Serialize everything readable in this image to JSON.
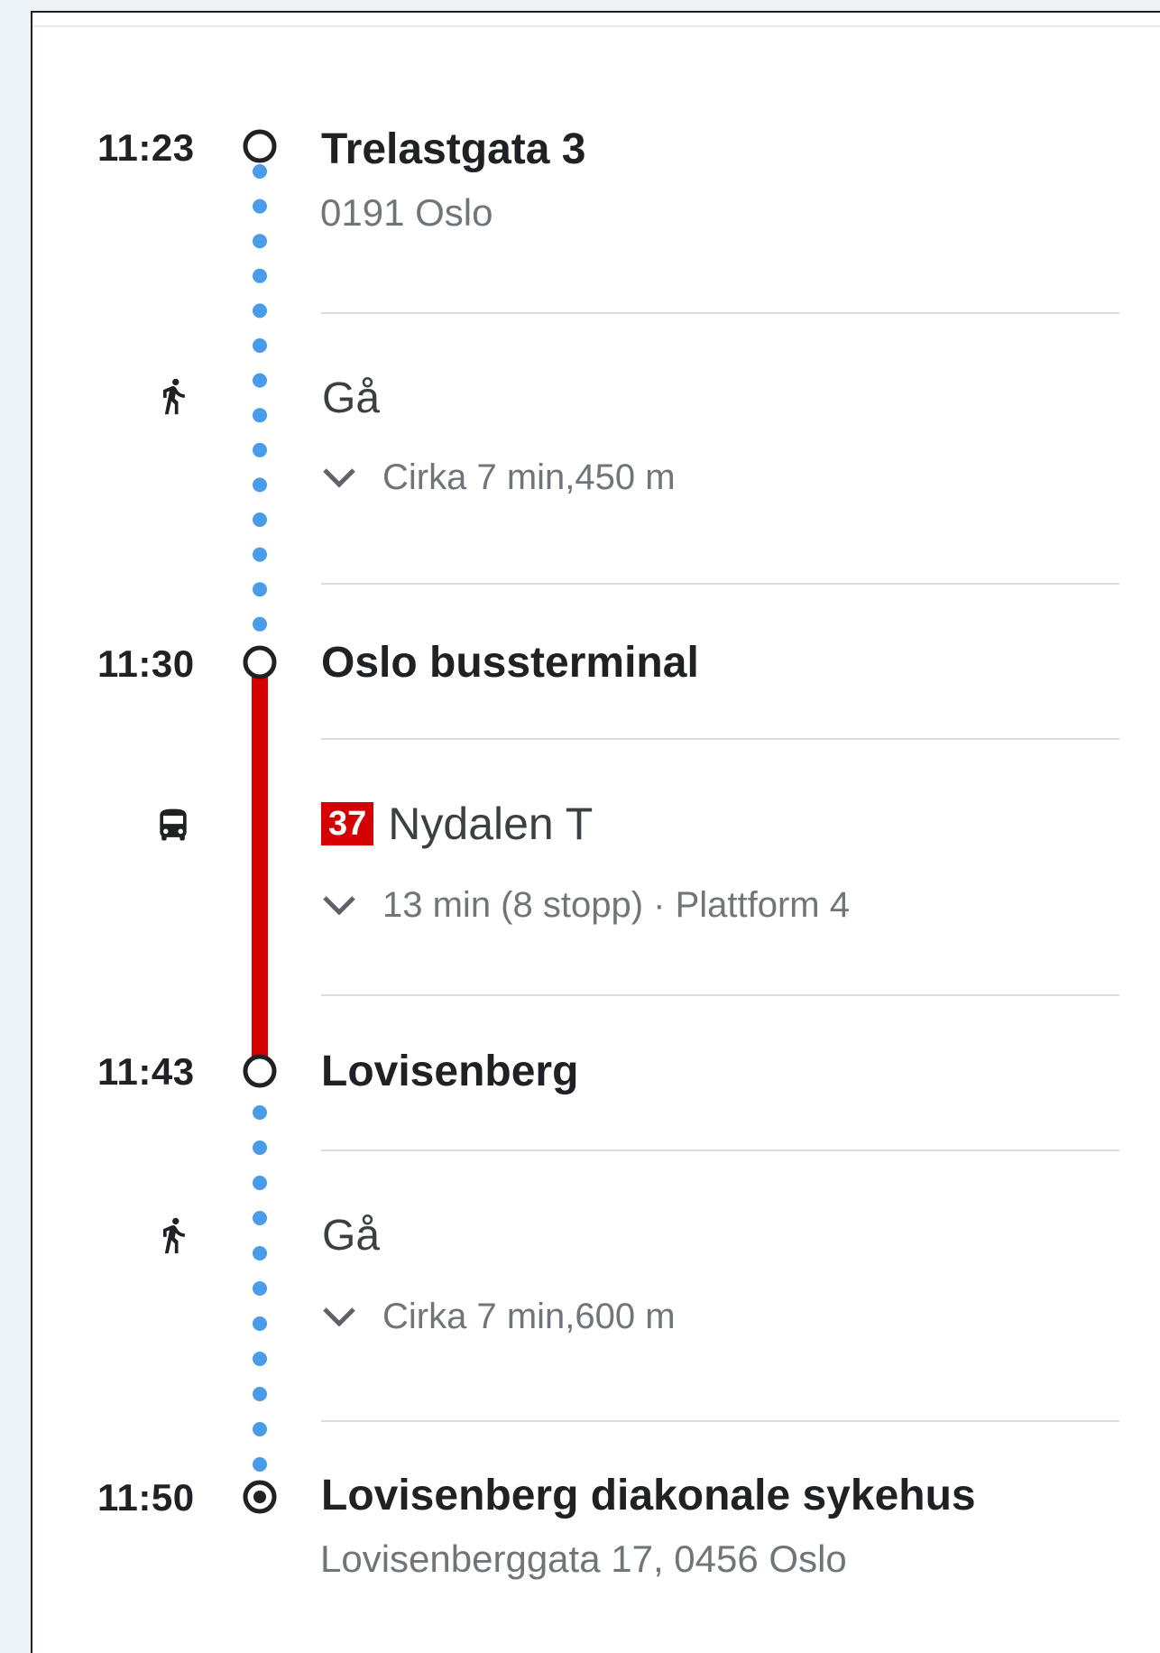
{
  "stops": [
    {
      "time": "11:23",
      "title": "Trelastgata 3",
      "subtitle": "0191 Oslo"
    },
    {
      "time": "11:30",
      "title": "Oslo bussterminal"
    },
    {
      "time": "11:43",
      "title": "Lovisenberg"
    },
    {
      "time": "11:50",
      "title": "Lovisenberg diakonale sykehus",
      "subtitle": "Lovisenberggata 17, 0456 Oslo"
    }
  ],
  "steps": [
    {
      "mode": "walk",
      "icon": "walk-icon",
      "label": "Gå",
      "detail": "Cirka 7 min,450 m"
    },
    {
      "mode": "bus",
      "icon": "bus-icon",
      "route_number": "37",
      "destination": "Nydalen T",
      "detail": "13 min (8 stopp) · Plattform 4",
      "route_color": "#d50000"
    },
    {
      "mode": "walk",
      "icon": "walk-icon",
      "label": "Gå",
      "detail": "Cirka 7 min,600 m"
    }
  ],
  "colors": {
    "walk_dots": "#4a9bea",
    "bus_line": "#d50000",
    "node_stroke": "#202124"
  }
}
